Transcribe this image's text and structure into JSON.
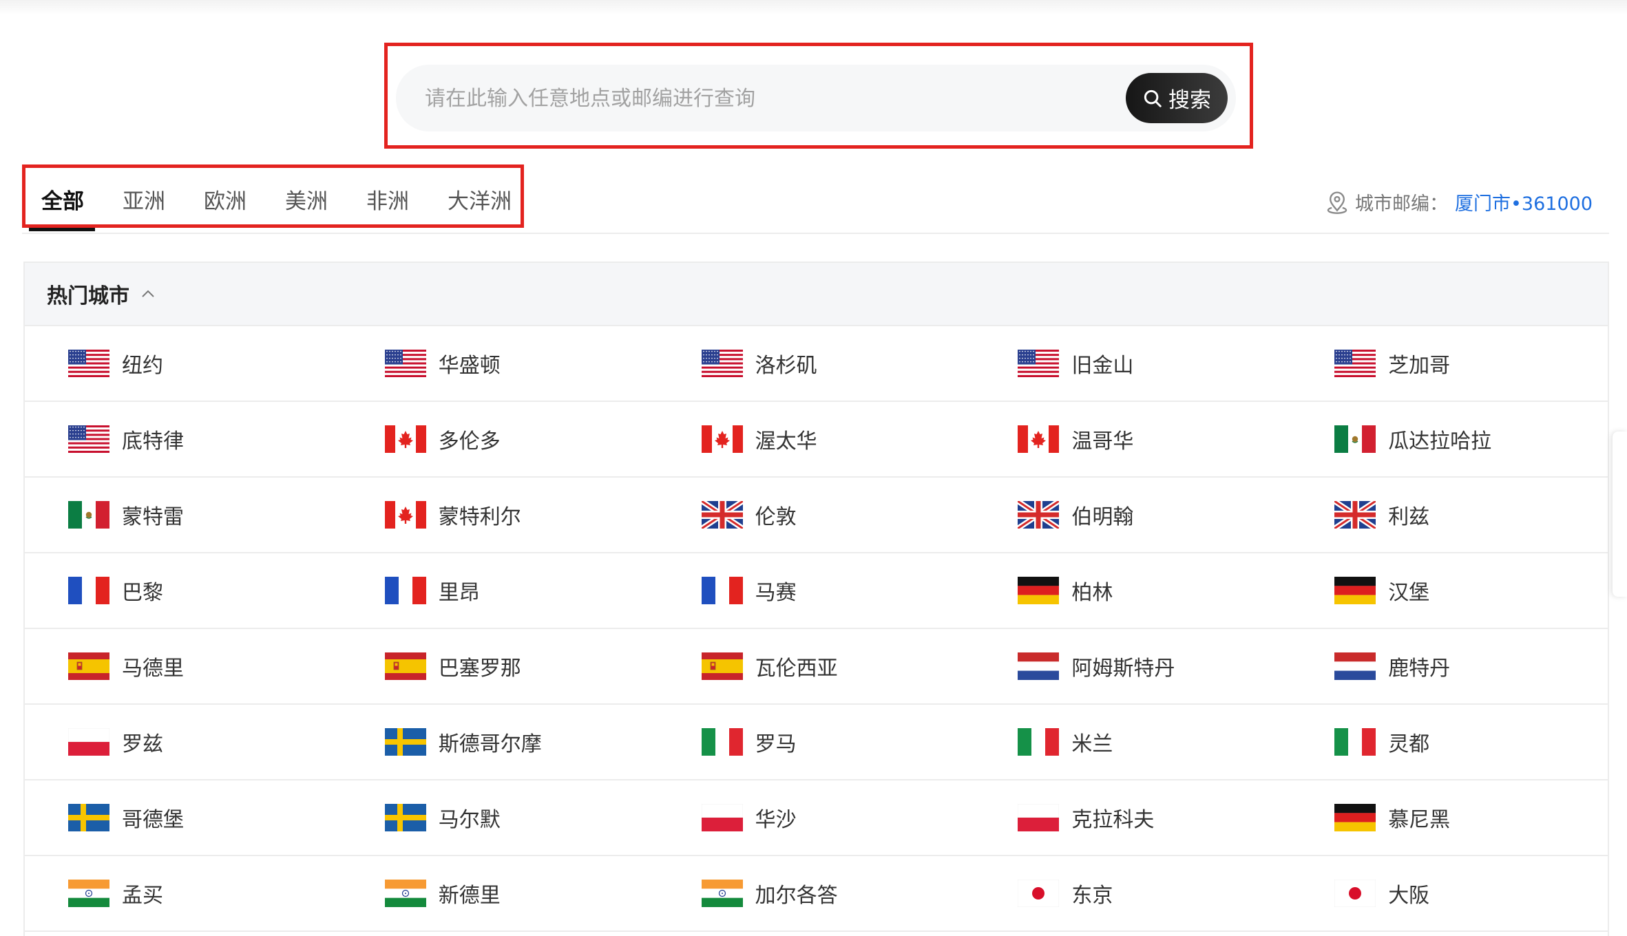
{
  "search": {
    "placeholder": "请在此输入任意地点或邮编进行查询",
    "button_label": "搜索"
  },
  "tabs": [
    {
      "label": "全部",
      "active": true
    },
    {
      "label": "亚洲",
      "active": false
    },
    {
      "label": "欧洲",
      "active": false
    },
    {
      "label": "美洲",
      "active": false
    },
    {
      "label": "非洲",
      "active": false
    },
    {
      "label": "大洋洲",
      "active": false
    }
  ],
  "location": {
    "label": "城市邮编：",
    "value": "厦门市•361000"
  },
  "hot_cities": {
    "title": "热门城市",
    "rows": [
      [
        {
          "name": "纽约",
          "flag": "us"
        },
        {
          "name": "华盛顿",
          "flag": "us"
        },
        {
          "name": "洛杉矶",
          "flag": "us"
        },
        {
          "name": "旧金山",
          "flag": "us"
        },
        {
          "name": "芝加哥",
          "flag": "us"
        }
      ],
      [
        {
          "name": "底特律",
          "flag": "us"
        },
        {
          "name": "多伦多",
          "flag": "ca"
        },
        {
          "name": "渥太华",
          "flag": "ca"
        },
        {
          "name": "温哥华",
          "flag": "ca"
        },
        {
          "name": "瓜达拉哈拉",
          "flag": "mx"
        }
      ],
      [
        {
          "name": "蒙特雷",
          "flag": "mx"
        },
        {
          "name": "蒙特利尔",
          "flag": "ca"
        },
        {
          "name": "伦敦",
          "flag": "gb"
        },
        {
          "name": "伯明翰",
          "flag": "gb"
        },
        {
          "name": "利兹",
          "flag": "gb"
        }
      ],
      [
        {
          "name": "巴黎",
          "flag": "fr"
        },
        {
          "name": "里昂",
          "flag": "fr"
        },
        {
          "name": "马赛",
          "flag": "fr"
        },
        {
          "name": "柏林",
          "flag": "de"
        },
        {
          "name": "汉堡",
          "flag": "de"
        }
      ],
      [
        {
          "name": "马德里",
          "flag": "es"
        },
        {
          "name": "巴塞罗那",
          "flag": "es"
        },
        {
          "name": "瓦伦西亚",
          "flag": "es"
        },
        {
          "name": "阿姆斯特丹",
          "flag": "nl"
        },
        {
          "name": "鹿特丹",
          "flag": "nl"
        }
      ],
      [
        {
          "name": "罗兹",
          "flag": "pl"
        },
        {
          "name": "斯德哥尔摩",
          "flag": "se"
        },
        {
          "name": "罗马",
          "flag": "it"
        },
        {
          "name": "米兰",
          "flag": "it"
        },
        {
          "name": "灵都",
          "flag": "it"
        }
      ],
      [
        {
          "name": "哥德堡",
          "flag": "se"
        },
        {
          "name": "马尔默",
          "flag": "se"
        },
        {
          "name": "华沙",
          "flag": "pl"
        },
        {
          "name": "克拉科夫",
          "flag": "pl"
        },
        {
          "name": "慕尼黑",
          "flag": "de"
        }
      ],
      [
        {
          "name": "孟买",
          "flag": "in"
        },
        {
          "name": "新德里",
          "flag": "in"
        },
        {
          "name": "加尔各答",
          "flag": "in"
        },
        {
          "name": "东京",
          "flag": "jp"
        },
        {
          "name": "大阪",
          "flag": "jp"
        }
      ]
    ]
  },
  "colors": {
    "highlight_box": "#e3231f",
    "link_blue": "#1e6fe0",
    "button_dark": "#161616"
  }
}
